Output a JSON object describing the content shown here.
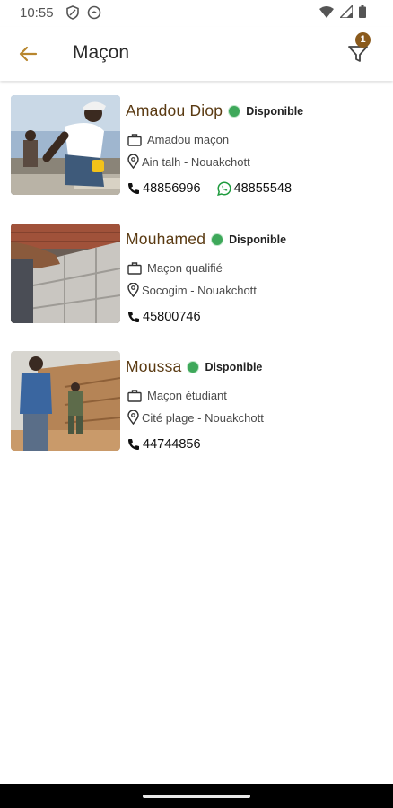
{
  "status_bar": {
    "time": "10:55"
  },
  "app_bar": {
    "title": "Maçon",
    "filter_count": "1"
  },
  "workers": [
    {
      "name": "Amadou Diop",
      "status": "Disponible",
      "job": "Amadou maçon",
      "location": "Ain talh - Nouakchott",
      "phone": "48856996",
      "whatsapp": "48855548"
    },
    {
      "name": "Mouhamed",
      "status": "Disponible",
      "job": "Maçon qualifié",
      "location": "Socogim - Nouakchott",
      "phone": "45800746"
    },
    {
      "name": "Moussa",
      "status": "Disponible",
      "job": "Maçon étudiant",
      "location": "Cité plage - Nouakchott",
      "phone": "44744856"
    }
  ],
  "colors": {
    "accent": "#8a5a1c",
    "name": "#5a3a12",
    "available": "#3ea85a",
    "whatsapp": "#25a244"
  }
}
